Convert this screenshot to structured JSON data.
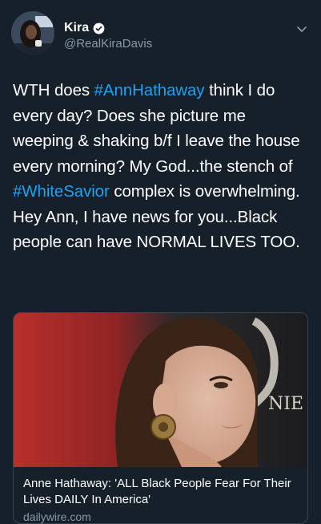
{
  "user": {
    "display_name": "Kira",
    "handle": "@RealKiraDavis",
    "verified": true
  },
  "tweet": {
    "segments": [
      {
        "text": "WTH does ",
        "hashtag": false
      },
      {
        "text": "#AnnHathaway",
        "hashtag": true
      },
      {
        "text": " think I do every day? Does she picture me weeping & shaking b/f I leave the house every morning? My God...the stench of ",
        "hashtag": false
      },
      {
        "text": "#WhiteSavior",
        "hashtag": true
      },
      {
        "text": " complex is overwhelming. Hey Ann, I have news for you...Black people can have NORMAL LIVES TOO.",
        "hashtag": false
      }
    ]
  },
  "card": {
    "title": "Anne Hathaway: 'ALL Black People Fear For Their Lives DAILY In America'",
    "domain": "dailywire.com",
    "image_text": "NIE"
  },
  "colors": {
    "background": "#15202b",
    "link": "#1da1f2",
    "secondary_text": "#8899a6",
    "border": "#38444d"
  }
}
